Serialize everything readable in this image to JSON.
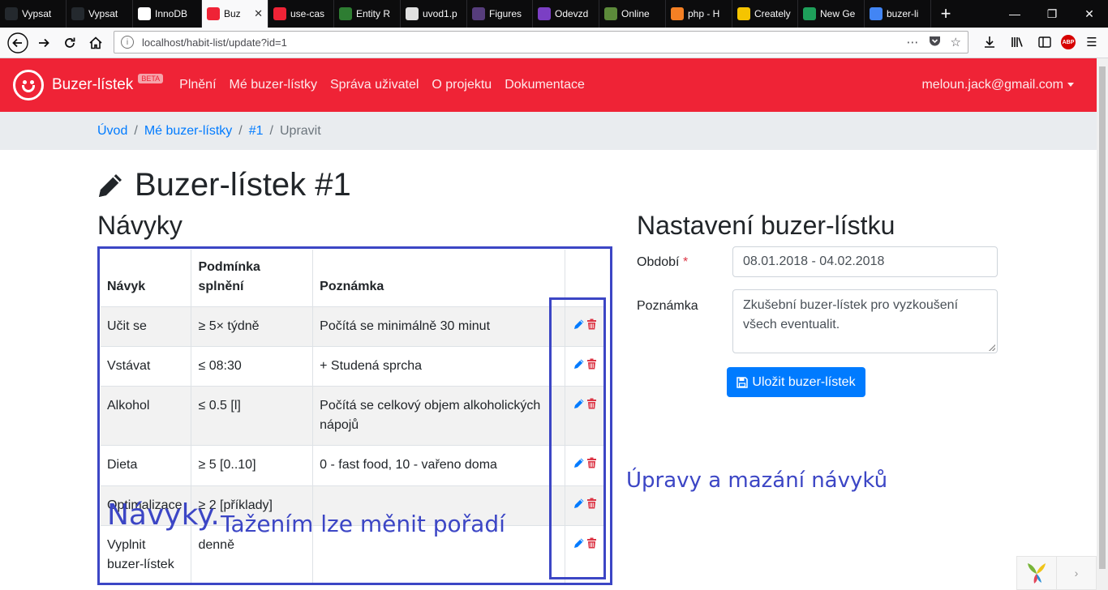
{
  "browser": {
    "tabs": [
      {
        "title": "Vypsat",
        "fav": "github-icon",
        "color": "#24292e",
        "active": false
      },
      {
        "title": "Vypsat",
        "fav": "github-icon",
        "color": "#24292e",
        "active": false
      },
      {
        "title": "InnoDB",
        "fav": "wikipedia-icon",
        "color": "#ffffff",
        "active": false
      },
      {
        "title": "Buz",
        "fav": "smiley-icon",
        "color": "#ef2336",
        "active": true
      },
      {
        "title": "use-cas",
        "fav": "smiley-icon",
        "color": "#ef2336",
        "active": false
      },
      {
        "title": "Entity R",
        "fav": "entity-icon",
        "color": "#2e7d32",
        "active": false
      },
      {
        "title": "uvod1.p",
        "fav": "document-icon",
        "color": "#e0e0e0",
        "active": false
      },
      {
        "title": "Figures",
        "fav": "bootstrap-icon",
        "color": "#563d7c",
        "active": false
      },
      {
        "title": "Odevzd",
        "fav": "list-icon",
        "color": "#7b3fc4",
        "active": false
      },
      {
        "title": "Online",
        "fav": "code-icon",
        "color": "#5c8a3a",
        "active": false
      },
      {
        "title": "php - H",
        "fav": "stackoverflow-icon",
        "color": "#f48024",
        "active": false
      },
      {
        "title": "Creately",
        "fav": "bulb-icon",
        "color": "#f5c400",
        "active": false
      },
      {
        "title": "New Ge",
        "fav": "sheet-icon",
        "color": "#1e9f5a",
        "active": false
      },
      {
        "title": "buzer-li",
        "fav": "google-icon",
        "color": "#4285f4",
        "active": false
      }
    ],
    "url": "localhost/habit-list/update?id=1"
  },
  "app": {
    "brand": "Buzer-lístek",
    "badge": "BETA",
    "menu": [
      "Plnění",
      "Mé buzer-lístky",
      "Správa uživatel",
      "O projektu",
      "Dokumentace"
    ],
    "user": "meloun.jack@gmail.com",
    "accent": "#ef2336"
  },
  "breadcrumb": {
    "home": "Úvod",
    "list": "Mé buzer-lístky",
    "item": "#1",
    "current": "Upravit",
    "sep": "/"
  },
  "page": {
    "title": "Buzer-lístek #1",
    "habits_heading": "Návyky",
    "settings_heading": "Nastavení buzer-lístku"
  },
  "habits": {
    "columns": [
      "Návyk",
      "Podmínka splnění",
      "Poznámka"
    ],
    "rows": [
      {
        "name": "Učit se",
        "condition": "≥ 5× týdně",
        "note": "Počítá se minimálně 30 minut"
      },
      {
        "name": "Vstávat",
        "condition": "≤ 08:30",
        "note": "+ Studená sprcha"
      },
      {
        "name": "Alkohol",
        "condition": "≤ 0.5 [l]",
        "note": "Počítá se celkový objem alkoholických nápojů"
      },
      {
        "name": "Dieta",
        "condition": "≥ 5 [0..10]",
        "note": "0 - fast food, 10 - vařeno doma"
      },
      {
        "name": "Optimalizace",
        "condition": "≥ 2 [příklady]",
        "note": ""
      },
      {
        "name": "Vyplnit buzer-lístek",
        "condition": "denně",
        "note": ""
      }
    ]
  },
  "form": {
    "period_label": "Období",
    "required_mark": "*",
    "period_value": "08.01.2018 - 04.02.2018",
    "note_label": "Poznámka",
    "note_value": "Zkušební buzer-lístek pro vyzkoušení všech eventualit.",
    "save_label": "Uložit buzer-lístek"
  },
  "annotations": {
    "edit_delete": "Úpravy a mazání návyků",
    "habits_word": "Návyky.",
    "drag_hint": "Tažením lze měnit pořadí",
    "color": "#3c46c5"
  }
}
